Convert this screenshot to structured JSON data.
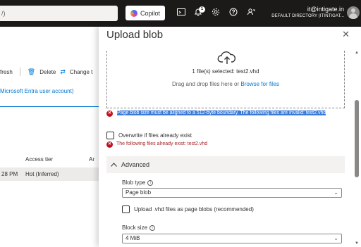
{
  "topbar": {
    "search_fragment": "/)",
    "copilot_label": "Copilot",
    "notification_count": "1",
    "account_email": "it@intigate.in",
    "account_directory": "DEFAULT DIRECTORY (ITINTIGAT..."
  },
  "background": {
    "toolbar": {
      "refresh_label": "fresh",
      "delete_label": "Delete",
      "change_label": "Change t"
    },
    "auth_link": "Microsoft Entra user account)",
    "columns": [
      "Access tier",
      "Ar"
    ],
    "row": {
      "time": "28 PM",
      "tier": "Hot (Inferred)"
    }
  },
  "panel": {
    "title": "Upload blob",
    "files_selected": "1 file(s) selected: test2.vhd",
    "drag_text": "Drag and drop files here",
    "or_text": "or",
    "browse_link": "Browse for files",
    "page_blob_error": "Page blob size must be aligned to a 512-byte boundary. The following files are invalid: test2.vhd",
    "overwrite_label": "Overwrite if files already exist",
    "exists_error": "The following files already exist: test2.vhd",
    "advanced_label": "Advanced",
    "blob_type_label": "Blob type",
    "blob_type_value": "Page blob",
    "vhd_checkbox_label": "Upload .vhd files as page blobs (recommended)",
    "block_size_label": "Block size",
    "block_size_value": "4 MiB"
  },
  "colors": {
    "accent": "#0078d4",
    "error": "#c50f1f",
    "selection": "#3879d9",
    "topbar": "#1b1a19"
  }
}
